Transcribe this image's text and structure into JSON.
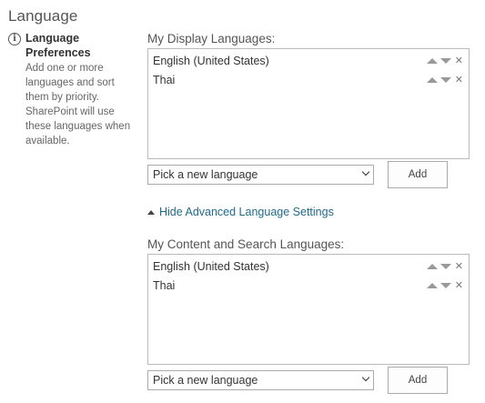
{
  "section": {
    "title": "Language"
  },
  "preferences": {
    "heading": "Language Preferences",
    "description": "Add one or more languages and sort them by priority. SharePoint will use these languages when available."
  },
  "display_languages": {
    "label": "My Display Languages:",
    "items": [
      {
        "name": "English (United States)"
      },
      {
        "name": "Thai"
      }
    ],
    "picker_value": "Pick a new language",
    "add_label": "Add"
  },
  "advanced": {
    "link_label": "Hide Advanced Language Settings"
  },
  "content_languages": {
    "label": "My Content and Search Languages:",
    "items": [
      {
        "name": "English (United States)"
      },
      {
        "name": "Thai"
      }
    ],
    "picker_value": "Pick a new language",
    "add_label": "Add"
  },
  "icons": {
    "info": "info-icon",
    "move_up": "arrow-up-icon",
    "move_down": "arrow-down-icon",
    "remove": "close-icon",
    "dropdown": "chevron-down-icon",
    "collapse": "triangle-up-icon"
  },
  "colors": {
    "link": "#1f6a8a",
    "border": "#bbbbbb",
    "text": "#444444"
  }
}
